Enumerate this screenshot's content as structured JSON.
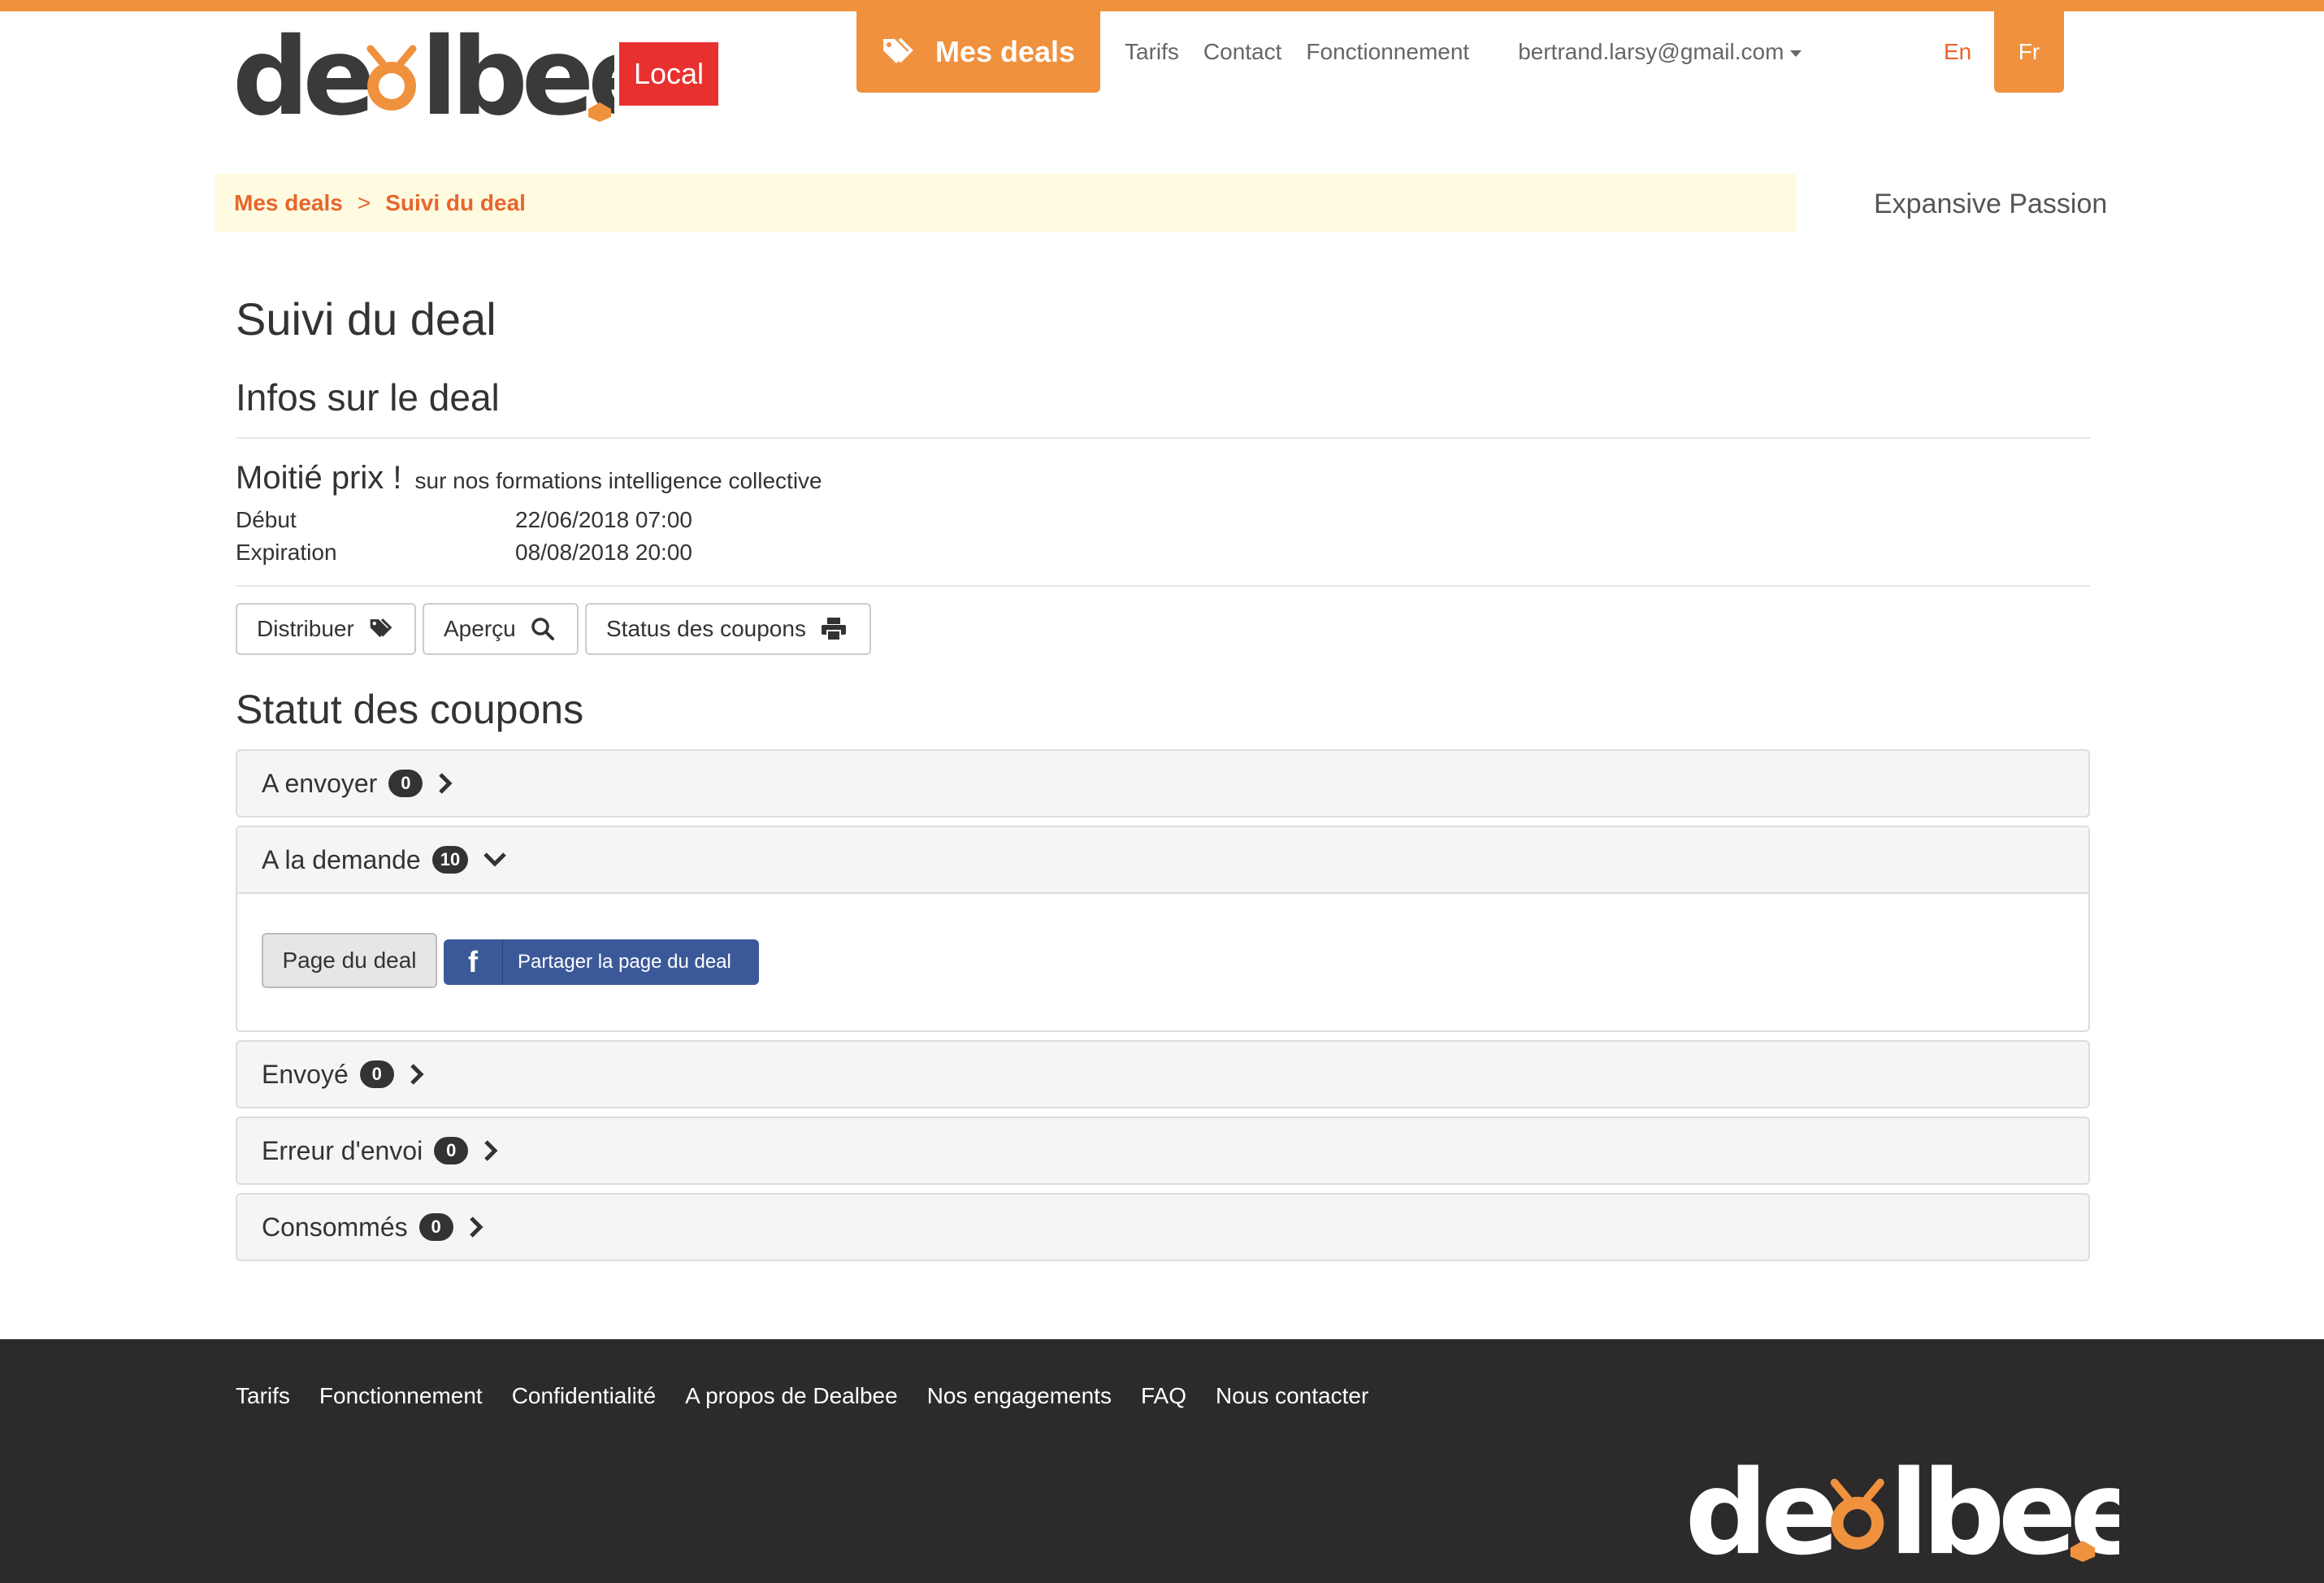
{
  "brand": {
    "logo_text": "dealbee.",
    "local_badge": "Local"
  },
  "nav": {
    "active_label": "Mes deals",
    "links": [
      "Tarifs",
      "Contact",
      "Fonctionnement"
    ],
    "user_email": "bertrand.larsy@gmail.com",
    "lang_en": "En",
    "lang_fr": "Fr"
  },
  "breadcrumb": {
    "items": [
      "Mes deals",
      "Suivi du deal"
    ],
    "separator": ">"
  },
  "company_name": "Expansive Passion",
  "page_title": "Suivi du deal",
  "info_section": {
    "title": "Infos sur le deal",
    "deal_title": "Moitié prix !",
    "deal_subtitle": "sur nos formations intelligence collective",
    "start_label": "Début",
    "start_value": "22/06/2018 07:00",
    "expiry_label": "Expiration",
    "expiry_value": "08/08/2018 20:00"
  },
  "actions": {
    "distribute": "Distribuer",
    "preview": "Aperçu",
    "coupon_status": "Status des coupons"
  },
  "coupons": {
    "title": "Statut des coupons",
    "panels": [
      {
        "label": "A envoyer",
        "count": "0",
        "expanded": false
      },
      {
        "label": "A la demande",
        "count": "10",
        "expanded": true
      },
      {
        "label": "Envoyé",
        "count": "0",
        "expanded": false
      },
      {
        "label": "Erreur d'envoi",
        "count": "0",
        "expanded": false
      },
      {
        "label": "Consommés",
        "count": "0",
        "expanded": false
      }
    ],
    "deal_page_button": "Page du deal",
    "share_button": "Partager la page du deal"
  },
  "footer": {
    "links": [
      "Tarifs",
      "Fonctionnement",
      "Confidentialité",
      "A propos de Dealbee",
      "Nos engagements",
      "FAQ",
      "Nous contacter"
    ]
  },
  "colors": {
    "accent": "#f0913e",
    "accent_text": "#e8652c",
    "badge_red": "#e8312f",
    "facebook": "#3b5998",
    "footer_bg": "#2c2a2a"
  }
}
